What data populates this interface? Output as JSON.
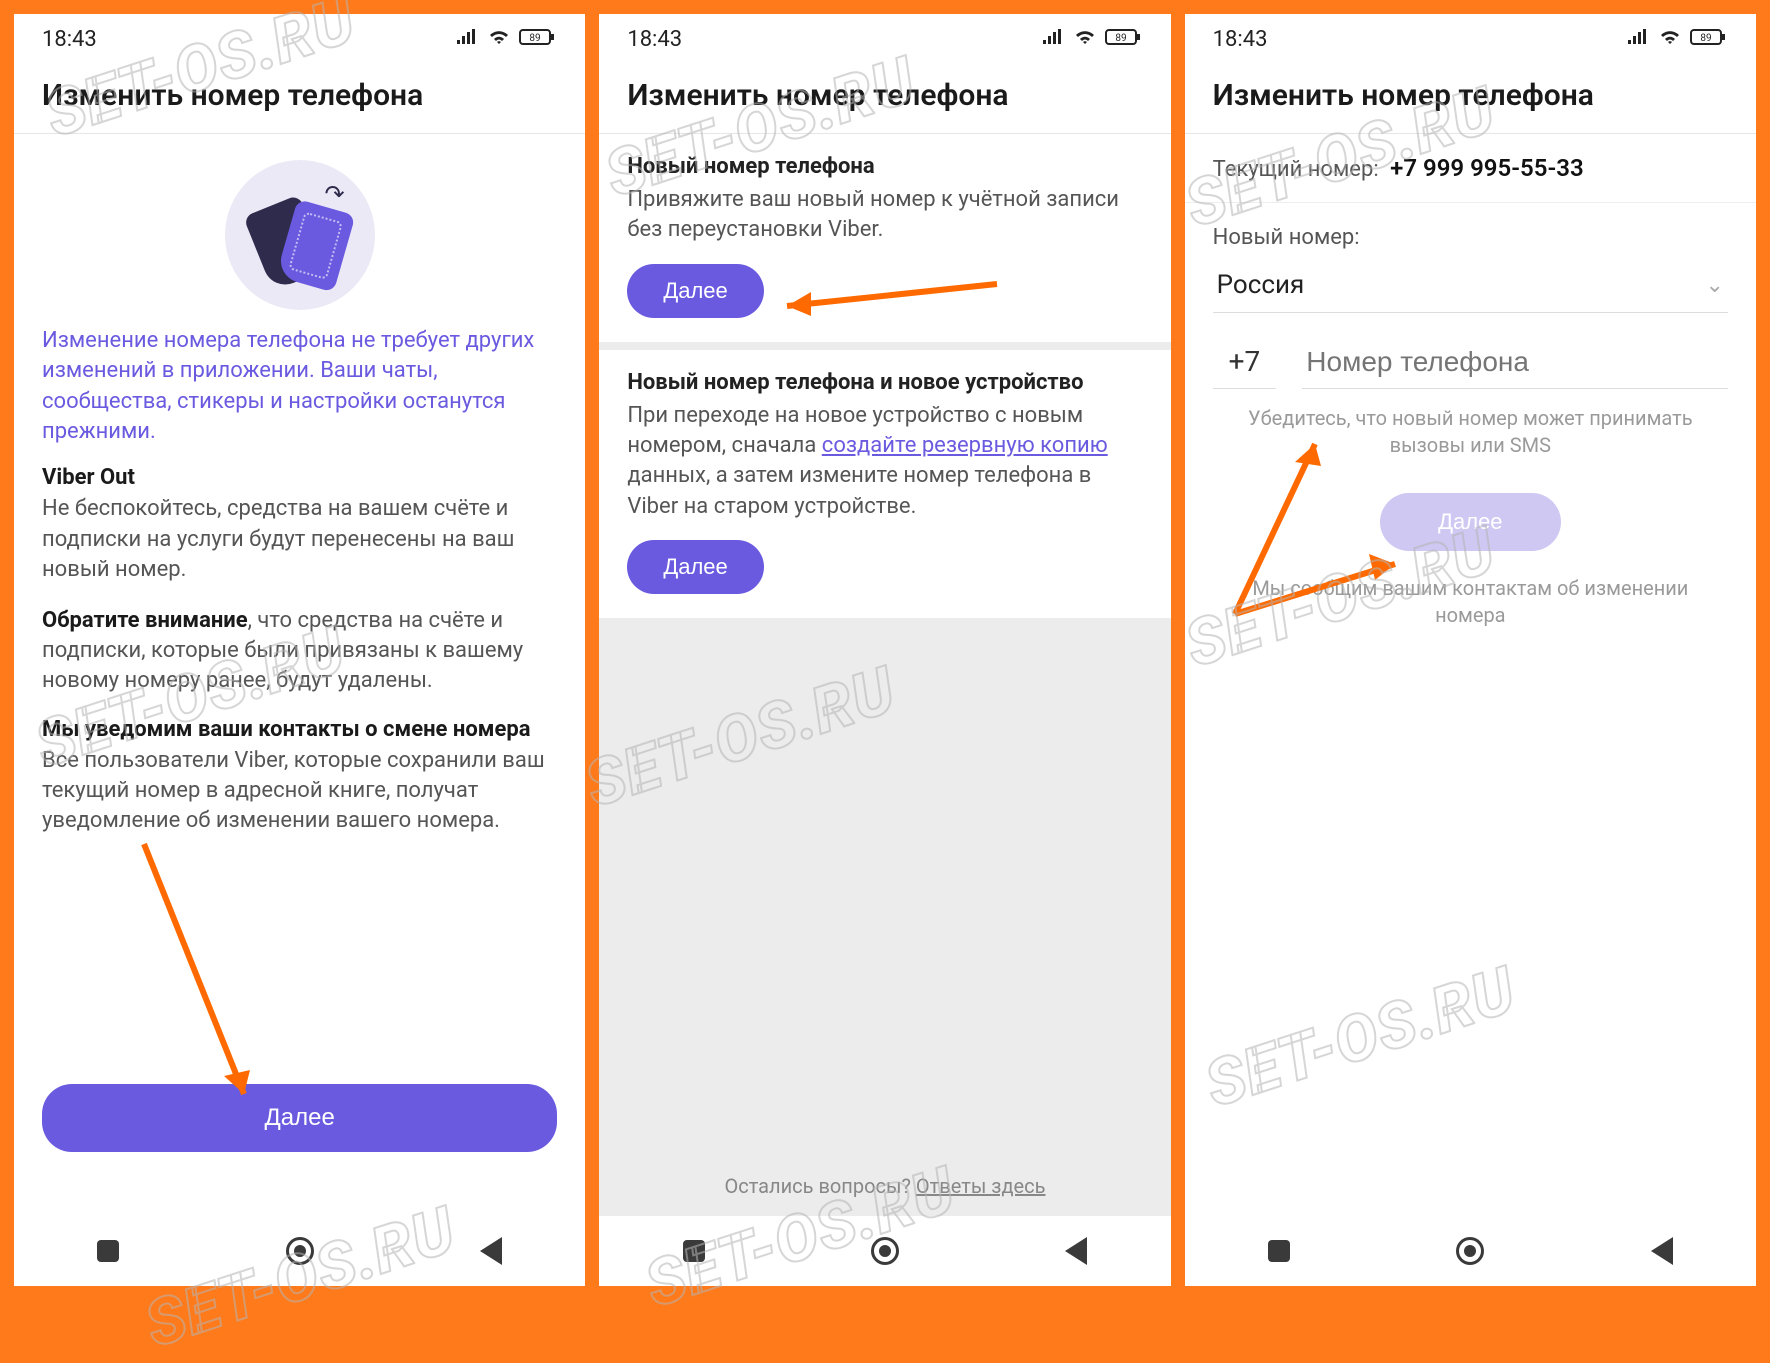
{
  "status": {
    "time": "18:43",
    "battery": "89"
  },
  "header_title": "Изменить номер телефона",
  "screen1": {
    "intro": "Изменение номера телефона не требует других изменений в приложении. Ваши чаты, сообщества, стикеры и настройки останутся прежними.",
    "viber_out_title": "Viber Out",
    "viber_out_text": "Не беспокойтесь, средства на вашем счёте и подписки на услуги будут перенесены на ваш новый номер.",
    "note_bold": "Обратите внимание",
    "note_text": ", что средства на счёте и подписки, которые были привязаны к вашему новому номеру ранее, будут удалены.",
    "notify_title": "Мы уведомим ваши контакты о смене номера",
    "notify_text": "Все пользователи Viber, которые сохранили ваш текущий номер в адресной книге, получат уведомление об изменении вашего номера.",
    "next": "Далее"
  },
  "screen2": {
    "sec1_title": "Новый номер телефона",
    "sec1_text": "Привяжите ваш новый номер к учётной записи без переустановки Viber.",
    "sec1_btn": "Далее",
    "sec2_title": "Новый номер телефона и новое устройство",
    "sec2_text_a": "При переходе на новое устройство с новым номером, сначала ",
    "sec2_link": "создайте резервную копию",
    "sec2_text_b": " данных, а затем измените номер телефона в Viber на старом устройстве.",
    "sec2_btn": "Далее",
    "faq_q": "Остались вопросы? ",
    "faq_link": "Ответы здесь"
  },
  "screen3": {
    "current_label": "Текущий номер:",
    "current_value": "+7 999 995-55-33",
    "new_label": "Новый номер:",
    "country": "Россия",
    "country_code": "+7",
    "placeholder": "Номер телефона",
    "hint": "Убедитесь, что новый номер может принимать вызовы или SMS",
    "next": "Далее",
    "note": "Мы сообщим вашим контактам об изменении номера"
  },
  "watermark": "SET-OS.RU"
}
